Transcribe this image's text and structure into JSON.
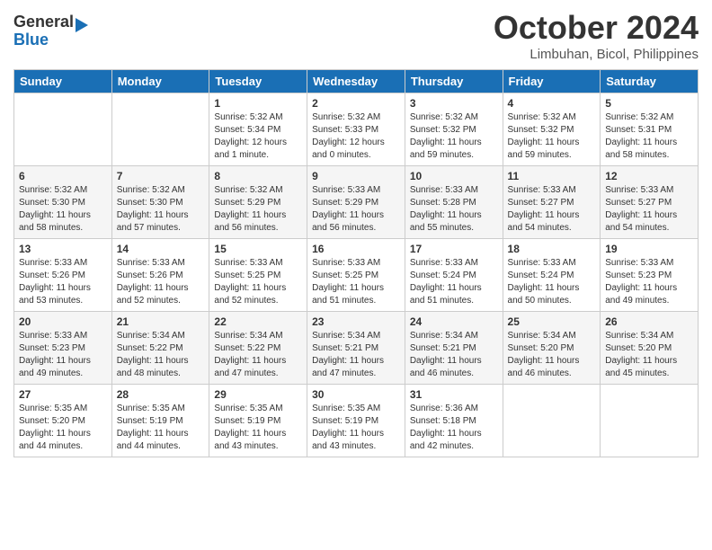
{
  "header": {
    "logo_line1": "General",
    "logo_line2": "Blue",
    "month_title": "October 2024",
    "subtitle": "Limbuhan, Bicol, Philippines"
  },
  "calendar": {
    "days_of_week": [
      "Sunday",
      "Monday",
      "Tuesday",
      "Wednesday",
      "Thursday",
      "Friday",
      "Saturday"
    ],
    "weeks": [
      [
        {
          "day": "",
          "info": ""
        },
        {
          "day": "",
          "info": ""
        },
        {
          "day": "1",
          "info": "Sunrise: 5:32 AM\nSunset: 5:34 PM\nDaylight: 12 hours\nand 1 minute."
        },
        {
          "day": "2",
          "info": "Sunrise: 5:32 AM\nSunset: 5:33 PM\nDaylight: 12 hours\nand 0 minutes."
        },
        {
          "day": "3",
          "info": "Sunrise: 5:32 AM\nSunset: 5:32 PM\nDaylight: 11 hours\nand 59 minutes."
        },
        {
          "day": "4",
          "info": "Sunrise: 5:32 AM\nSunset: 5:32 PM\nDaylight: 11 hours\nand 59 minutes."
        },
        {
          "day": "5",
          "info": "Sunrise: 5:32 AM\nSunset: 5:31 PM\nDaylight: 11 hours\nand 58 minutes."
        }
      ],
      [
        {
          "day": "6",
          "info": "Sunrise: 5:32 AM\nSunset: 5:30 PM\nDaylight: 11 hours\nand 58 minutes."
        },
        {
          "day": "7",
          "info": "Sunrise: 5:32 AM\nSunset: 5:30 PM\nDaylight: 11 hours\nand 57 minutes."
        },
        {
          "day": "8",
          "info": "Sunrise: 5:32 AM\nSunset: 5:29 PM\nDaylight: 11 hours\nand 56 minutes."
        },
        {
          "day": "9",
          "info": "Sunrise: 5:33 AM\nSunset: 5:29 PM\nDaylight: 11 hours\nand 56 minutes."
        },
        {
          "day": "10",
          "info": "Sunrise: 5:33 AM\nSunset: 5:28 PM\nDaylight: 11 hours\nand 55 minutes."
        },
        {
          "day": "11",
          "info": "Sunrise: 5:33 AM\nSunset: 5:27 PM\nDaylight: 11 hours\nand 54 minutes."
        },
        {
          "day": "12",
          "info": "Sunrise: 5:33 AM\nSunset: 5:27 PM\nDaylight: 11 hours\nand 54 minutes."
        }
      ],
      [
        {
          "day": "13",
          "info": "Sunrise: 5:33 AM\nSunset: 5:26 PM\nDaylight: 11 hours\nand 53 minutes."
        },
        {
          "day": "14",
          "info": "Sunrise: 5:33 AM\nSunset: 5:26 PM\nDaylight: 11 hours\nand 52 minutes."
        },
        {
          "day": "15",
          "info": "Sunrise: 5:33 AM\nSunset: 5:25 PM\nDaylight: 11 hours\nand 52 minutes."
        },
        {
          "day": "16",
          "info": "Sunrise: 5:33 AM\nSunset: 5:25 PM\nDaylight: 11 hours\nand 51 minutes."
        },
        {
          "day": "17",
          "info": "Sunrise: 5:33 AM\nSunset: 5:24 PM\nDaylight: 11 hours\nand 51 minutes."
        },
        {
          "day": "18",
          "info": "Sunrise: 5:33 AM\nSunset: 5:24 PM\nDaylight: 11 hours\nand 50 minutes."
        },
        {
          "day": "19",
          "info": "Sunrise: 5:33 AM\nSunset: 5:23 PM\nDaylight: 11 hours\nand 49 minutes."
        }
      ],
      [
        {
          "day": "20",
          "info": "Sunrise: 5:33 AM\nSunset: 5:23 PM\nDaylight: 11 hours\nand 49 minutes."
        },
        {
          "day": "21",
          "info": "Sunrise: 5:34 AM\nSunset: 5:22 PM\nDaylight: 11 hours\nand 48 minutes."
        },
        {
          "day": "22",
          "info": "Sunrise: 5:34 AM\nSunset: 5:22 PM\nDaylight: 11 hours\nand 47 minutes."
        },
        {
          "day": "23",
          "info": "Sunrise: 5:34 AM\nSunset: 5:21 PM\nDaylight: 11 hours\nand 47 minutes."
        },
        {
          "day": "24",
          "info": "Sunrise: 5:34 AM\nSunset: 5:21 PM\nDaylight: 11 hours\nand 46 minutes."
        },
        {
          "day": "25",
          "info": "Sunrise: 5:34 AM\nSunset: 5:20 PM\nDaylight: 11 hours\nand 46 minutes."
        },
        {
          "day": "26",
          "info": "Sunrise: 5:34 AM\nSunset: 5:20 PM\nDaylight: 11 hours\nand 45 minutes."
        }
      ],
      [
        {
          "day": "27",
          "info": "Sunrise: 5:35 AM\nSunset: 5:20 PM\nDaylight: 11 hours\nand 44 minutes."
        },
        {
          "day": "28",
          "info": "Sunrise: 5:35 AM\nSunset: 5:19 PM\nDaylight: 11 hours\nand 44 minutes."
        },
        {
          "day": "29",
          "info": "Sunrise: 5:35 AM\nSunset: 5:19 PM\nDaylight: 11 hours\nand 43 minutes."
        },
        {
          "day": "30",
          "info": "Sunrise: 5:35 AM\nSunset: 5:19 PM\nDaylight: 11 hours\nand 43 minutes."
        },
        {
          "day": "31",
          "info": "Sunrise: 5:36 AM\nSunset: 5:18 PM\nDaylight: 11 hours\nand 42 minutes."
        },
        {
          "day": "",
          "info": ""
        },
        {
          "day": "",
          "info": ""
        }
      ]
    ]
  }
}
